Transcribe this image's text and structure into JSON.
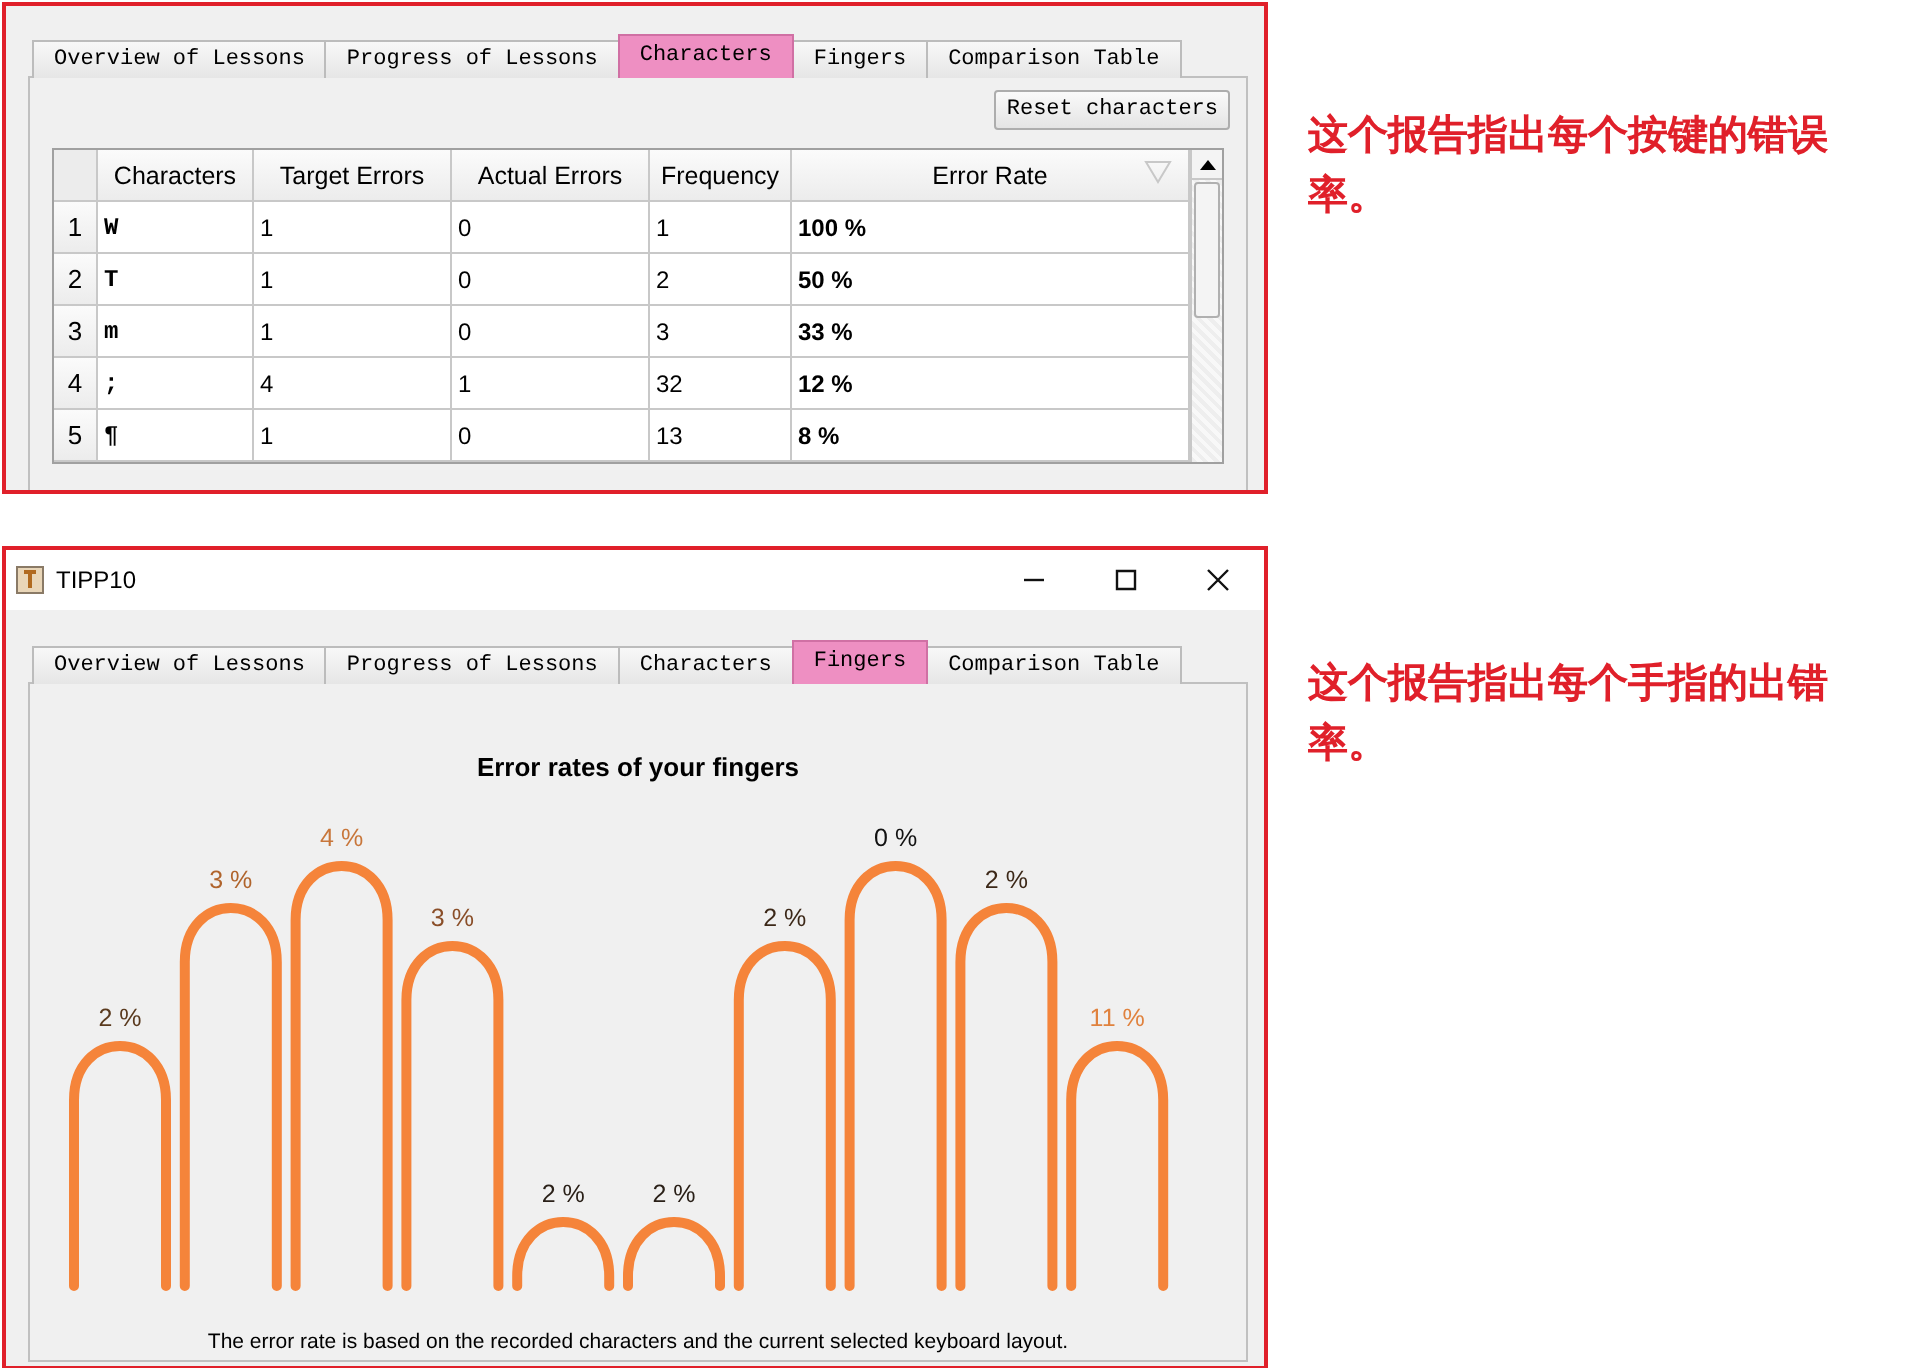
{
  "panels": [
    {
      "kind": "characters",
      "tabs": [
        {
          "label": "Overview of Lessons",
          "selected": false
        },
        {
          "label": "Progress of Lessons",
          "selected": false
        },
        {
          "label": "Characters",
          "selected": true
        },
        {
          "label": "Fingers",
          "selected": false
        },
        {
          "label": "Comparison Table",
          "selected": false
        }
      ],
      "reset_button": "Reset characters",
      "table": {
        "columns": [
          "Characters",
          "Target Errors",
          "Actual Errors",
          "Frequency",
          "Error Rate"
        ],
        "rows": [
          {
            "index": "1",
            "cells": [
              "W",
              "1",
              "0",
              "1",
              "100 %"
            ]
          },
          {
            "index": "2",
            "cells": [
              "T",
              "1",
              "0",
              "2",
              "50 %"
            ]
          },
          {
            "index": "3",
            "cells": [
              "m",
              "1",
              "0",
              "3",
              "33 %"
            ]
          },
          {
            "index": "4",
            "cells": [
              ";",
              "4",
              "1",
              "32",
              "12 %"
            ]
          },
          {
            "index": "5",
            "cells": [
              "¶",
              "1",
              "0",
              "13",
              "8 %"
            ]
          }
        ]
      }
    },
    {
      "kind": "fingers",
      "window": {
        "title": "TIPP10"
      },
      "tabs": [
        {
          "label": "Overview of Lessons",
          "selected": false
        },
        {
          "label": "Progress of Lessons",
          "selected": false
        },
        {
          "label": "Characters",
          "selected": false
        },
        {
          "label": "Fingers",
          "selected": true
        },
        {
          "label": "Comparison Table",
          "selected": false
        }
      ],
      "chart_title": "Error rates of your fingers",
      "fingers": [
        {
          "label": "2 %",
          "color": "#5a3a1e"
        },
        {
          "label": "3 %",
          "color": "#b0642c"
        },
        {
          "label": "4 %",
          "color": "#c8763a"
        },
        {
          "label": "3 %",
          "color": "#8a4e28"
        },
        {
          "label": "2 %",
          "color": "#2a2018"
        },
        {
          "label": "2 %",
          "color": "#2a2018"
        },
        {
          "label": "2 %",
          "color": "#3c2818"
        },
        {
          "label": "0 %",
          "color": "#111111"
        },
        {
          "label": "2 %",
          "color": "#3c2818"
        },
        {
          "label": "11 %",
          "color": "#e0823e"
        }
      ],
      "footnote": "The error rate is based on the recorded characters and the current selected keyboard layout."
    }
  ],
  "annotations": [
    {
      "text": "这个报告指出每个按键的错误率。"
    },
    {
      "text": "这个报告指出每个手指的出错率。"
    }
  ]
}
